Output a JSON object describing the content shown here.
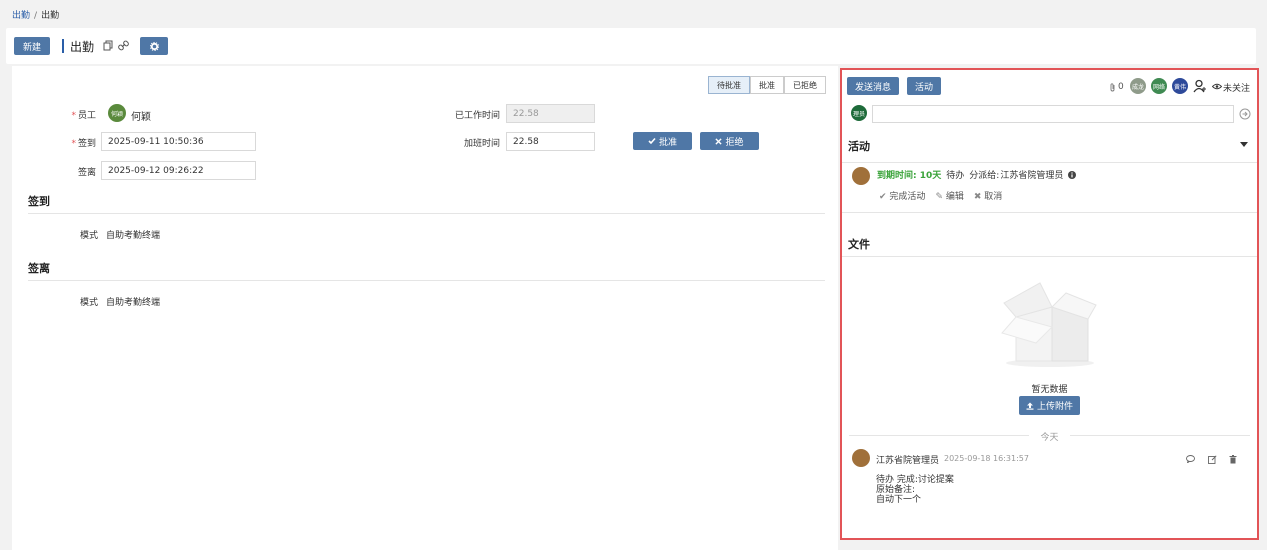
{
  "breadcrumb": {
    "parent": "出勤",
    "separator": "/",
    "current": "出勤"
  },
  "toolbar": {
    "new_label": "新建",
    "title": "出勤"
  },
  "statusbar": {
    "steps": [
      "待批准",
      "批准",
      "已拒绝"
    ]
  },
  "form": {
    "employee_label": "员工",
    "employee_avatar": "何颖",
    "employee_name": "何颖",
    "checkin_label": "签到",
    "checkin_value": "2025-09-11 10:50:36",
    "checkout_label": "签离",
    "checkout_value": "2025-09-12 09:26:22",
    "worked_label": "已工作时间",
    "worked_value": "22.58",
    "overtime_label": "加班时间",
    "overtime_value": "22.58",
    "approve_label": "批准",
    "reject_label": "拒绝"
  },
  "checkin_section": {
    "title": "签到",
    "mode_label": "模式",
    "mode_value": "自助考勤终端"
  },
  "checkout_section": {
    "title": "签离",
    "mode_label": "模式",
    "mode_value": "自助考勤终端"
  },
  "chatter": {
    "send_message": "发送消息",
    "activity_button": "活动",
    "attachments_count": "0",
    "follower_avatars": [
      "成龙",
      "网络",
      "黄伟"
    ],
    "follow_label": "未关注",
    "composer_avatar": "理员",
    "activities_title": "活动",
    "activity": {
      "due": "到期时间: 10天",
      "type": "待办",
      "assigned_prefix": "分派给:",
      "assigned_to": "江苏省院管理员",
      "complete": "完成活动",
      "edit": "编辑",
      "cancel": "取消"
    },
    "files_title": "文件",
    "no_data": "暂无数据",
    "upload": "上传附件",
    "today": "今天",
    "message": {
      "author": "江苏省院管理员",
      "time": "2025-09-18 16:31:57",
      "lines": [
        "待办 完成:讨论提案",
        "原始备注:",
        "自动下一个"
      ]
    }
  },
  "colors": {
    "primary": "#4f77a6",
    "highlight_border": "#e25457",
    "due_green": "#3aa33a"
  }
}
